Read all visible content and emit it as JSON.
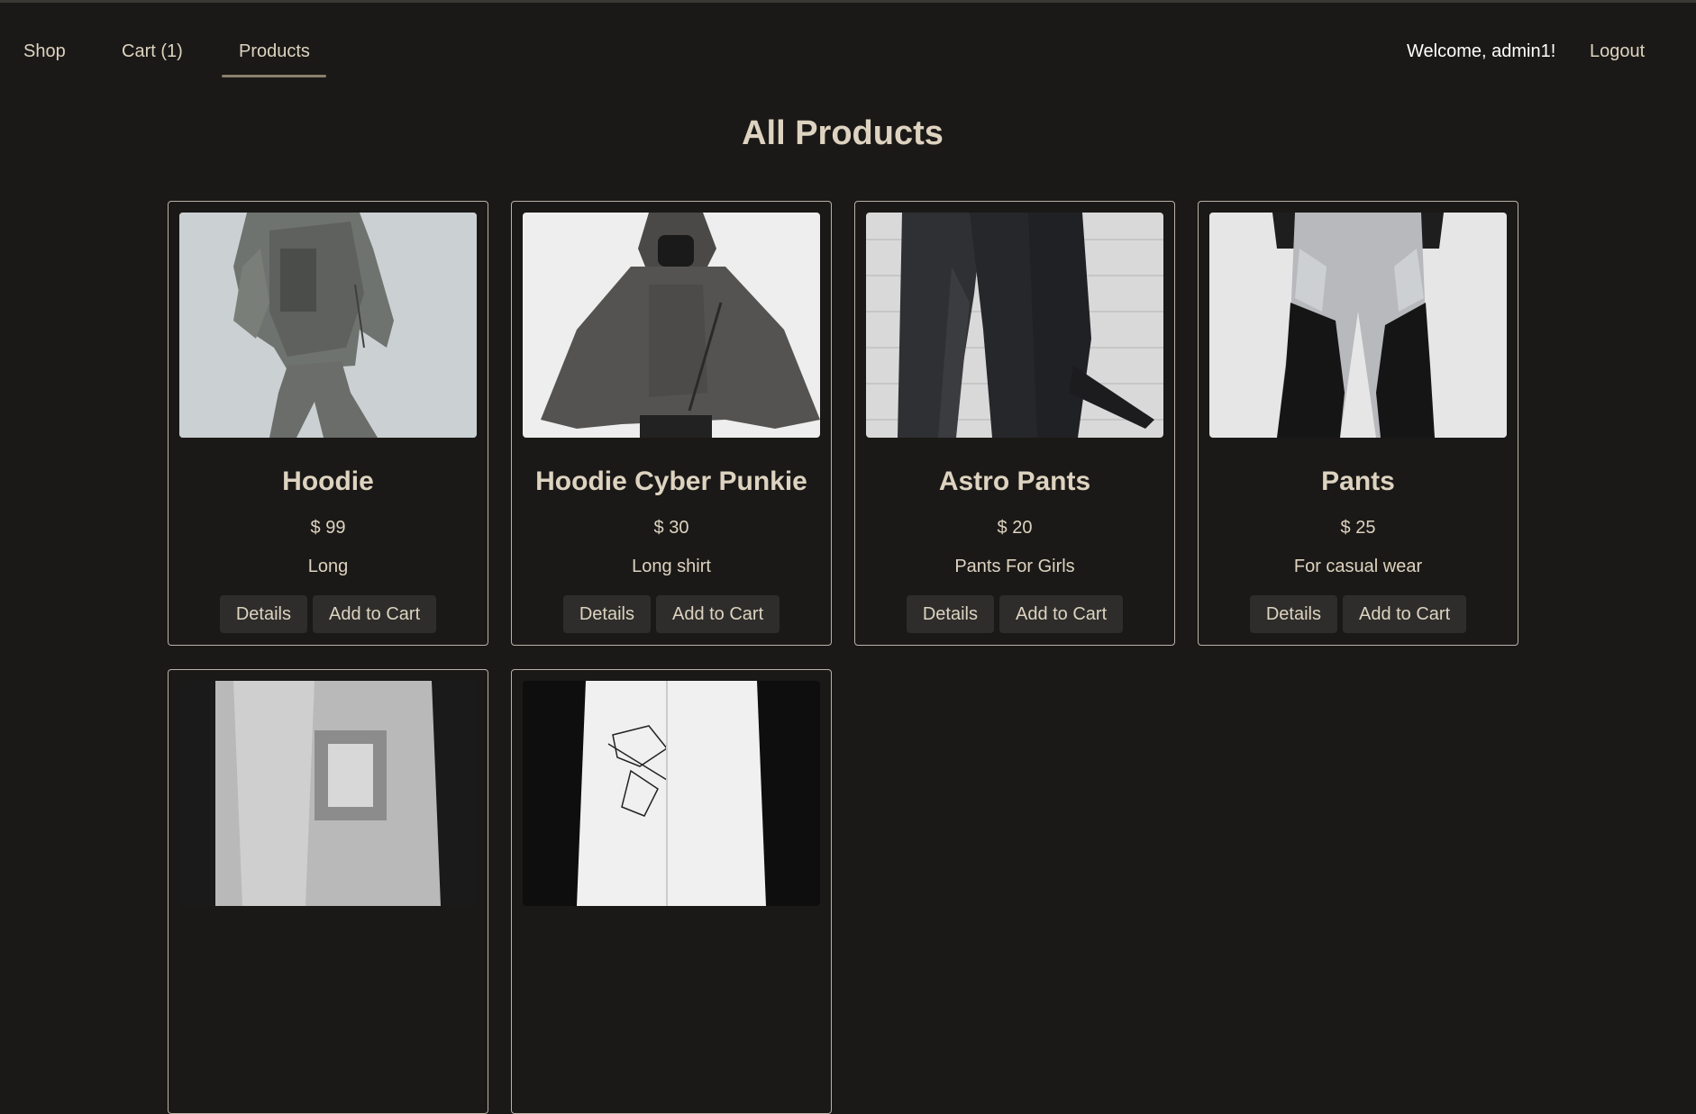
{
  "nav": {
    "shop_label": "Shop",
    "cart_label": "Cart (1)",
    "products_label": "Products",
    "welcome_text": "Welcome, admin1!",
    "logout_label": "Logout"
  },
  "page": {
    "title": "All Products"
  },
  "products": [
    {
      "name": "Hoodie",
      "price": "$ 99",
      "description": "Long",
      "details_label": "Details",
      "add_label": "Add to Cart"
    },
    {
      "name": "Hoodie Cyber Punkie",
      "price": "$ 30",
      "description": "Long shirt",
      "details_label": "Details",
      "add_label": "Add to Cart"
    },
    {
      "name": "Astro Pants",
      "price": "$ 20",
      "description": "Pants For Girls",
      "details_label": "Details",
      "add_label": "Add to Cart"
    },
    {
      "name": "Pants",
      "price": "$ 25",
      "description": "For casual wear",
      "details_label": "Details",
      "add_label": "Add to Cart"
    },
    {
      "name": "",
      "price": "",
      "description": "",
      "details_label": "",
      "add_label": ""
    },
    {
      "name": "",
      "price": "",
      "description": "",
      "details_label": "",
      "add_label": ""
    }
  ],
  "colors": {
    "background": "#1b1917",
    "text": "#ddd3c0",
    "button_bg": "#2e2d2b",
    "card_border": "#b8b2a8",
    "active_underline": "#8a7f6c"
  }
}
